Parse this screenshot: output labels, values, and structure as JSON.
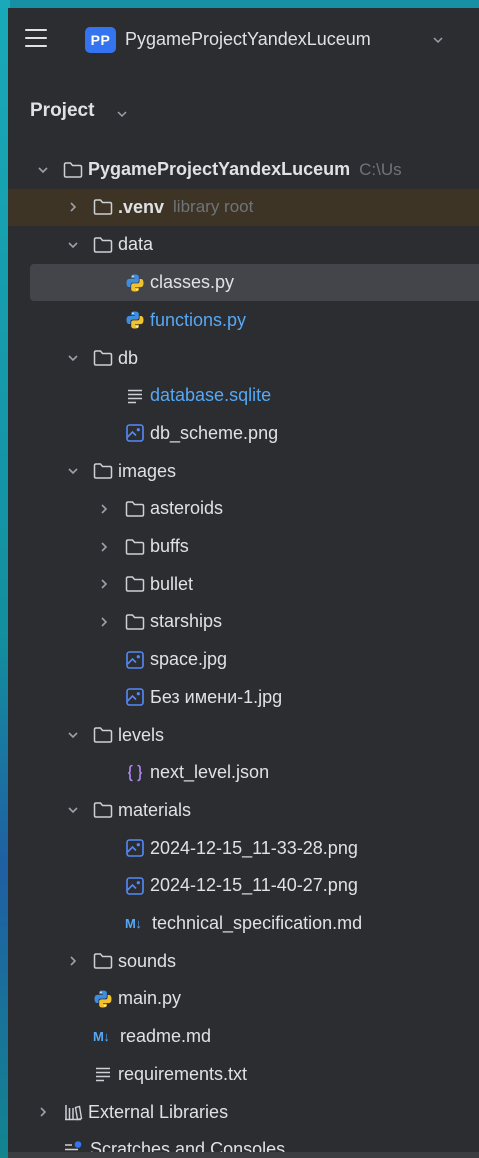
{
  "header": {
    "badge": "PP",
    "project_name": "PygameProjectYandexLuceum"
  },
  "pane": {
    "title": "Project"
  },
  "tree": [
    {
      "label": "PygameProjectYandexLuceum",
      "hint": "C:\\Us",
      "depth": 0,
      "chevron": "down",
      "icon": "folder",
      "bold": true
    },
    {
      "label": ".venv",
      "hint": "library root",
      "depth": 1,
      "chevron": "right",
      "icon": "folder",
      "bold": true,
      "highlight": true
    },
    {
      "label": "data",
      "depth": 1,
      "chevron": "down",
      "icon": "folder"
    },
    {
      "label": "classes.py",
      "depth": 2,
      "icon": "python",
      "selected": true
    },
    {
      "label": "functions.py",
      "depth": 2,
      "icon": "python",
      "color": "blue"
    },
    {
      "label": "db",
      "depth": 1,
      "chevron": "down",
      "icon": "folder"
    },
    {
      "label": "database.sqlite",
      "depth": 2,
      "icon": "text",
      "color": "blue"
    },
    {
      "label": "db_scheme.png",
      "depth": 2,
      "icon": "image"
    },
    {
      "label": "images",
      "depth": 1,
      "chevron": "down",
      "icon": "folder"
    },
    {
      "label": "asteroids",
      "depth": 2,
      "chevron": "right",
      "icon": "folder"
    },
    {
      "label": "buffs",
      "depth": 2,
      "chevron": "right",
      "icon": "folder"
    },
    {
      "label": "bullet",
      "depth": 2,
      "chevron": "right",
      "icon": "folder"
    },
    {
      "label": "starships",
      "depth": 2,
      "chevron": "right",
      "icon": "folder"
    },
    {
      "label": "space.jpg",
      "depth": 2,
      "icon": "image"
    },
    {
      "label": "Без имени-1.jpg",
      "depth": 2,
      "icon": "image"
    },
    {
      "label": "levels",
      "depth": 1,
      "chevron": "down",
      "icon": "folder"
    },
    {
      "label": "next_level.json",
      "depth": 2,
      "icon": "json"
    },
    {
      "label": "materials",
      "depth": 1,
      "chevron": "down",
      "icon": "folder"
    },
    {
      "label": "2024-12-15_11-33-28.png",
      "depth": 2,
      "icon": "image"
    },
    {
      "label": "2024-12-15_11-40-27.png",
      "depth": 2,
      "icon": "image"
    },
    {
      "label": "technical_specification.md",
      "depth": 2,
      "icon": "markdown",
      "md_text": "M↓"
    },
    {
      "label": "sounds",
      "depth": 1,
      "chevron": "right",
      "icon": "folder"
    },
    {
      "label": "main.py",
      "depth": 1,
      "icon": "python"
    },
    {
      "label": "readme.md",
      "depth": 1,
      "icon": "markdown",
      "md_text": "M↓"
    },
    {
      "label": "requirements.txt",
      "depth": 1,
      "icon": "text"
    },
    {
      "label": "External Libraries",
      "depth": 0,
      "chevron": "right",
      "icon": "library"
    },
    {
      "label": "Scratches and Consoles",
      "depth": 0,
      "icon": "scratches"
    }
  ],
  "colors": {
    "accent": "#3574f0",
    "link_blue": "#56a8f5",
    "selection": "#43454a",
    "venv_highlight": "#3d3425",
    "background": "#2b2d30"
  }
}
